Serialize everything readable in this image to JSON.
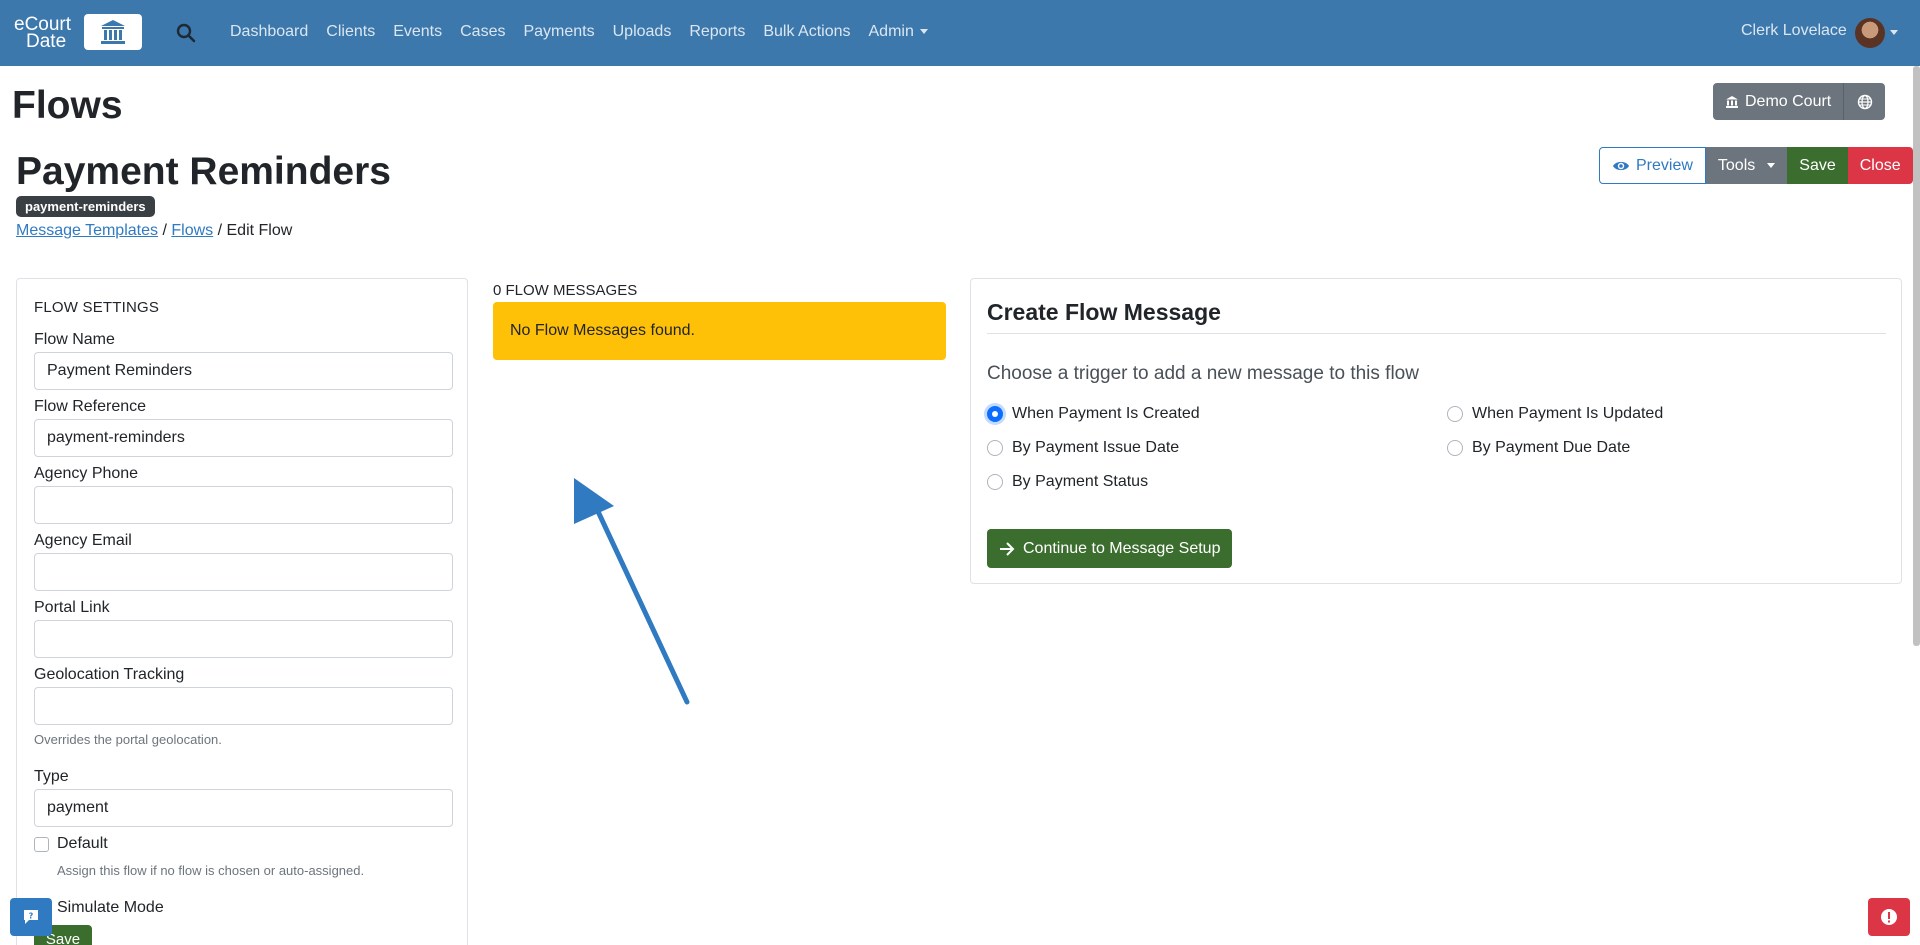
{
  "navbar": {
    "brand_line1": "eCourt",
    "brand_line2": "Date",
    "links": [
      "Dashboard",
      "Clients",
      "Events",
      "Cases",
      "Payments",
      "Uploads",
      "Reports",
      "Bulk Actions"
    ],
    "admin_label": "Admin",
    "user_name": "Clerk Lovelace"
  },
  "header": {
    "page_title": "Flows",
    "court_label": "Demo Court"
  },
  "flow": {
    "title": "Payment Reminders",
    "badge": "payment-reminders",
    "breadcrumb": {
      "templates": "Message Templates",
      "sep1": "/",
      "flows": "Flows",
      "sep2": "/",
      "current": "Edit Flow"
    },
    "actions": {
      "preview": "Preview",
      "tools": "Tools",
      "save": "Save",
      "close": "Close"
    }
  },
  "settings": {
    "heading": "FLOW SETTINGS",
    "flow_name_label": "Flow Name",
    "flow_name_value": "Payment Reminders",
    "flow_ref_label": "Flow Reference",
    "flow_ref_value": "payment-reminders",
    "agency_phone_label": "Agency Phone",
    "agency_phone_value": "",
    "agency_email_label": "Agency Email",
    "agency_email_value": "",
    "portal_link_label": "Portal Link",
    "portal_link_value": "",
    "geo_label": "Geolocation Tracking",
    "geo_value": "",
    "geo_help": "Overrides the portal geolocation.",
    "type_label": "Type",
    "type_value": "payment",
    "default_label": "Default",
    "default_help": "Assign this flow if no flow is chosen or auto-assigned.",
    "simulate_label": "Simulate Mode",
    "save_label": "Save"
  },
  "messages": {
    "heading": "0 FLOW MESSAGES",
    "empty_alert": "No Flow Messages found."
  },
  "create": {
    "title": "Create Flow Message",
    "subtitle": "Choose a trigger to add a new message to this flow",
    "triggers": [
      {
        "label": "When Payment Is Created",
        "checked": true
      },
      {
        "label": "When Payment Is Updated",
        "checked": false
      },
      {
        "label": "By Payment Issue Date",
        "checked": false
      },
      {
        "label": "By Payment Due Date",
        "checked": false
      },
      {
        "label": "By Payment Status",
        "checked": false
      }
    ],
    "continue_label": "Continue to Message Setup"
  },
  "colors": {
    "navbar": "#3c78ac",
    "primary": "#2f7ac1",
    "success": "#3b6e2e",
    "danger": "#dc3545",
    "warning": "#ffc107",
    "secondary": "#6c757d"
  }
}
